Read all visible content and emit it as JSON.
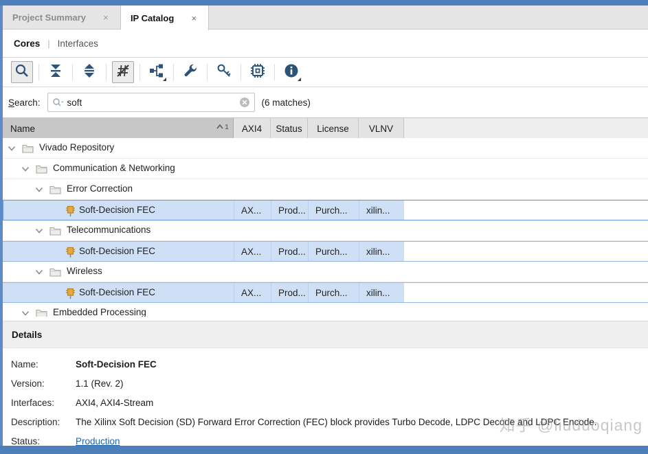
{
  "window_title": "IP Catalog",
  "colors": {
    "window_border": "#4d80ba",
    "selection_bg": "#cfe0f6",
    "selection_border": "#93b5e2",
    "icon_navy": "#2d5379",
    "ip_icon_orange": "#e2a945",
    "link_blue": "#2064ae"
  },
  "tabs": [
    {
      "label": "Project Summary",
      "active": false,
      "close": "×"
    },
    {
      "label": "IP Catalog",
      "active": true,
      "close": "×"
    }
  ],
  "subtabs": {
    "items": [
      {
        "label": "Cores",
        "active": true
      },
      {
        "label": "Interfaces",
        "active": false
      }
    ],
    "separator": "|"
  },
  "toolbar": {
    "buttons": [
      {
        "id": "search",
        "pressed": true,
        "menu": false
      },
      {
        "id": "collapse-all",
        "pressed": false,
        "menu": false
      },
      {
        "id": "expand-all",
        "pressed": false,
        "menu": false
      },
      {
        "id": "filter-unsupported",
        "pressed": true,
        "menu": false
      },
      {
        "id": "group-hierarchy",
        "pressed": false,
        "menu": true
      },
      {
        "id": "settings-wrench",
        "pressed": false,
        "menu": false
      },
      {
        "id": "license-key",
        "pressed": false,
        "menu": false
      },
      {
        "id": "ip-settings-chip",
        "pressed": false,
        "menu": false
      },
      {
        "id": "info",
        "pressed": false,
        "menu": true
      }
    ]
  },
  "search": {
    "label": "Search:",
    "value": "soft",
    "matches": "(6 matches)"
  },
  "table": {
    "columns": [
      {
        "label": "Name",
        "sort": "1"
      },
      {
        "label": "AXI4"
      },
      {
        "label": "Status"
      },
      {
        "label": "License"
      },
      {
        "label": "VLNV"
      }
    ],
    "rows": [
      {
        "indent": 0,
        "kind": "folder",
        "label": "Vivado Repository",
        "selected": false
      },
      {
        "indent": 1,
        "kind": "folder",
        "label": "Communication & Networking",
        "selected": false
      },
      {
        "indent": 2,
        "kind": "folder",
        "label": "Error Correction",
        "selected": false
      },
      {
        "indent": 3,
        "kind": "ip",
        "label": "Soft-Decision FEC",
        "selected": true,
        "focused": true,
        "cells": [
          "AX...",
          "Prod...",
          "Purch...",
          "xilin..."
        ]
      },
      {
        "indent": 2,
        "kind": "folder",
        "label": "Telecommunications",
        "selected": false
      },
      {
        "indent": 3,
        "kind": "ip",
        "label": "Soft-Decision FEC",
        "selected": true,
        "cells": [
          "AX...",
          "Prod...",
          "Purch...",
          "xilin..."
        ]
      },
      {
        "indent": 2,
        "kind": "folder",
        "label": "Wireless",
        "selected": false
      },
      {
        "indent": 3,
        "kind": "ip",
        "label": "Soft-Decision FEC",
        "selected": true,
        "cells": [
          "AX...",
          "Prod...",
          "Purch...",
          "xilin..."
        ]
      },
      {
        "indent": 1,
        "kind": "folder",
        "label": "Embedded Processing",
        "selected": false
      }
    ]
  },
  "details": {
    "title": "Details",
    "fields": [
      {
        "label": "Name:",
        "value": "Soft-Decision FEC",
        "bold": true,
        "link": false
      },
      {
        "label": "Version:",
        "value": "1.1 (Rev. 2)",
        "bold": false,
        "link": false
      },
      {
        "label": "Interfaces:",
        "value": "AXI4, AXI4-Stream",
        "bold": false,
        "link": false
      },
      {
        "label": "Description:",
        "value": "The Xilinx Soft Decision (SD) Forward Error Correction (FEC) block provides Turbo Decode, LDPC Decode and LDPC Encode.",
        "bold": false,
        "link": false
      },
      {
        "label": "Status:",
        "value": "Production",
        "bold": false,
        "link": true
      }
    ]
  },
  "watermark": "知乎 @liuduoqiang"
}
